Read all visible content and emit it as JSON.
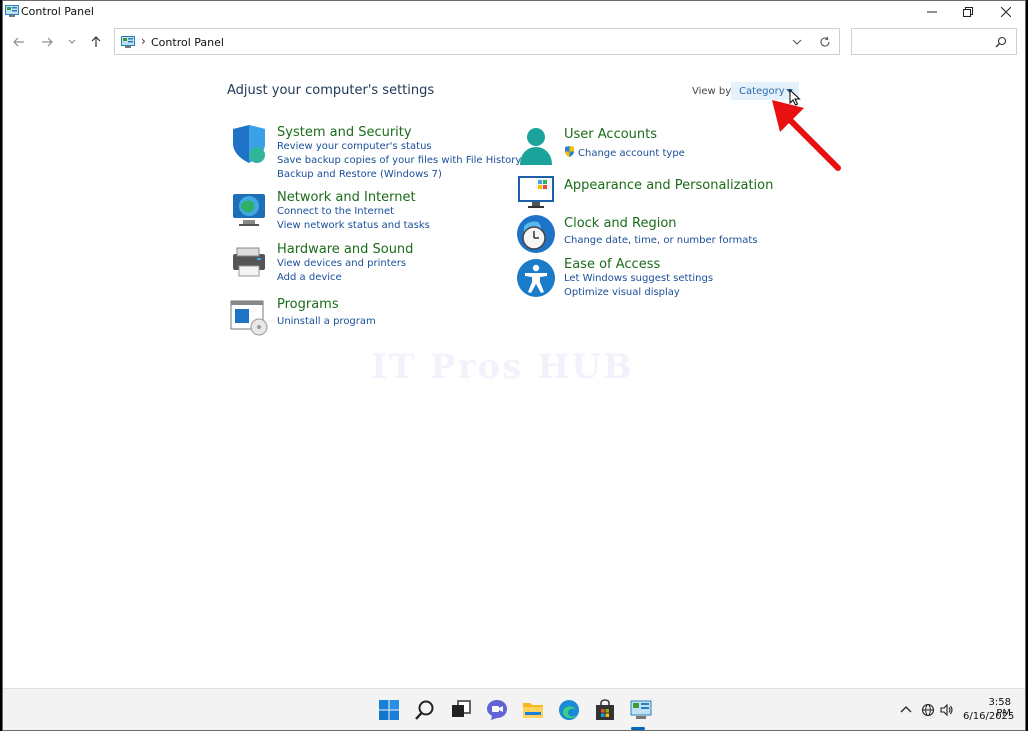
{
  "window": {
    "title": "Control Panel"
  },
  "address": {
    "path": "Control Panel",
    "separator": "›"
  },
  "search": {
    "placeholder": ""
  },
  "content": {
    "heading": "Adjust your computer's settings",
    "view_by_label": "View by:",
    "view_by_value": "Category"
  },
  "categories_left": [
    {
      "title": "System and Security",
      "links": [
        "Review your computer's status",
        "Save backup copies of your files with File History",
        "Backup and Restore (Windows 7)"
      ]
    },
    {
      "title": "Network and Internet",
      "links": [
        "Connect to the Internet",
        "View network status and tasks"
      ]
    },
    {
      "title": "Hardware and Sound",
      "links": [
        "View devices and printers",
        "Add a device"
      ]
    },
    {
      "title": "Programs",
      "links": [
        "Uninstall a program"
      ]
    }
  ],
  "categories_right": [
    {
      "title": "User Accounts",
      "links": [
        "Change account type"
      ]
    },
    {
      "title": "Appearance and Personalization",
      "links": []
    },
    {
      "title": "Clock and Region",
      "links": [
        "Change date, time, or number formats"
      ]
    },
    {
      "title": "Ease of Access",
      "links": [
        "Let Windows suggest settings",
        "Optimize visual display"
      ]
    }
  ],
  "watermark": "IT Pros HUB",
  "taskbar": {
    "icons": [
      "windows-start-icon",
      "search-icon",
      "task-view-icon",
      "chat-icon",
      "file-explorer-icon",
      "edge-icon",
      "store-icon",
      "control-panel-icon"
    ],
    "time": "3:58 PM",
    "date": "6/16/2025"
  },
  "colors": {
    "accent": "#0067c0",
    "title_green": "#1a6b1a",
    "link_blue": "#1a4f9a",
    "annotation_red": "#e81010"
  }
}
